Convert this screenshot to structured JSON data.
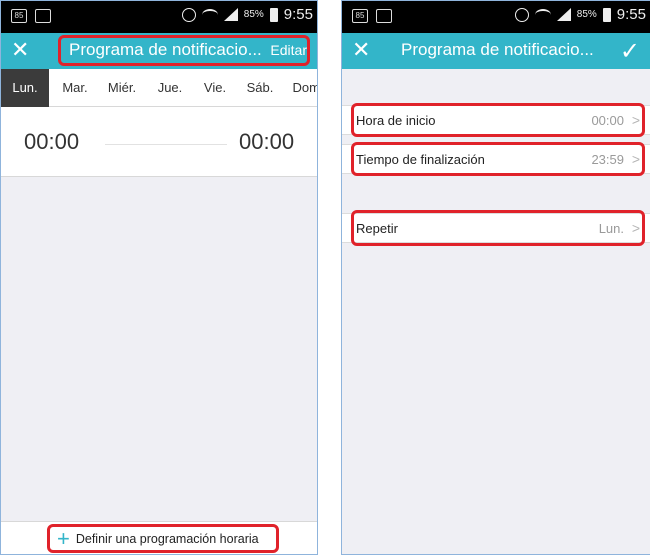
{
  "left": {
    "status": {
      "battery": "85%",
      "time": "9:55"
    },
    "title": "Programa de notificacio...",
    "edit_label": "Editar",
    "days": [
      "Lun.",
      "Mar.",
      "Miér.",
      "Jue.",
      "Vie.",
      "Sáb.",
      "Dom"
    ],
    "start_time": "00:00",
    "end_time": "00:00",
    "add_schedule_label": "Definir una programación horaria"
  },
  "right": {
    "status": {
      "battery": "85%",
      "time": "9:55"
    },
    "title": "Programa de notificacio...",
    "settings": [
      {
        "label": "Hora de inicio",
        "value": "00:00"
      },
      {
        "label": "Tiempo de finalización",
        "value": "23:59"
      },
      {
        "label": "Repetir",
        "value": "Lun."
      }
    ]
  },
  "colors": {
    "accent": "#33b5c9",
    "highlight": "#e0222a",
    "background": "#efeff4"
  }
}
